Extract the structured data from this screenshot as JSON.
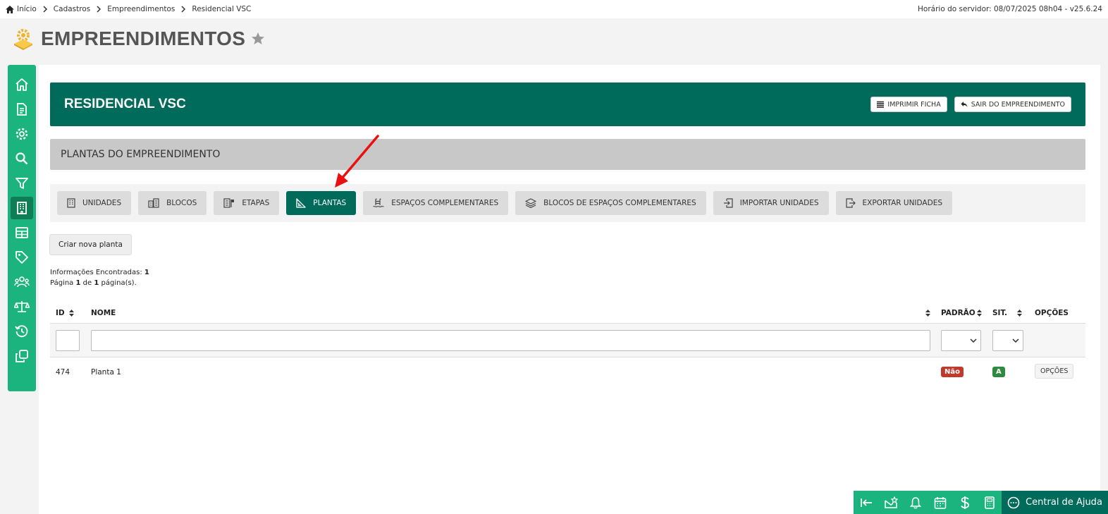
{
  "breadcrumb": {
    "items": [
      "Início",
      "Cadastros",
      "Empreendimentos",
      "Residencial VSC"
    ]
  },
  "server_time": "Horário do servidor: 08/07/2025 08h04 - v25.6.24",
  "page": {
    "title": "EMPREENDIMENTOS"
  },
  "sidebar": {
    "items": [
      {
        "icon": "home-icon"
      },
      {
        "icon": "document-icon"
      },
      {
        "icon": "gear-icon"
      },
      {
        "icon": "search-icon"
      },
      {
        "icon": "filter-icon"
      },
      {
        "icon": "building-icon",
        "active": true
      },
      {
        "icon": "table-icon"
      },
      {
        "icon": "tag-icon"
      },
      {
        "icon": "users-icon"
      },
      {
        "icon": "scale-icon"
      },
      {
        "icon": "history-icon"
      },
      {
        "icon": "copy-icon"
      }
    ]
  },
  "header": {
    "title": "RESIDENCIAL VSC",
    "print_label": "IMPRIMIR FICHA",
    "exit_label": "SAIR DO EMPREENDIMENTO"
  },
  "section": {
    "title": "PLANTAS DO EMPREENDIMENTO"
  },
  "tabs": [
    {
      "label": "UNIDADES",
      "icon": "building-icon"
    },
    {
      "label": "BLOCOS",
      "icon": "blocks-icon"
    },
    {
      "label": "ETAPAS",
      "icon": "stages-icon"
    },
    {
      "label": "PLANTAS",
      "icon": "ruler-triangle-icon",
      "active": true
    },
    {
      "label": "ESPAÇOS COMPLEMENTARES",
      "icon": "pool-icon"
    },
    {
      "label": "BLOCOS DE ESPAÇOS COMPLEMENTARES",
      "icon": "layers-icon"
    },
    {
      "label": "IMPORTAR UNIDADES",
      "icon": "import-icon"
    },
    {
      "label": "EXPORTAR UNIDADES",
      "icon": "export-icon"
    }
  ],
  "actions": {
    "new_plan": "Criar nova planta"
  },
  "info": {
    "found_label": "Informações Encontradas:",
    "found_count": "1",
    "page_prefix": "Página",
    "page_current": "1",
    "page_of": "de",
    "page_total": "1",
    "page_suffix": "página(s)."
  },
  "table": {
    "columns": {
      "id": "ID",
      "name": "NOME",
      "default": "PADRÃO",
      "status": "SIT.",
      "options": "OPÇÕES"
    },
    "rows": [
      {
        "id": "474",
        "name": "Planta 1",
        "default": "Não",
        "status": "A",
        "options": "OPÇÕES"
      }
    ]
  },
  "footer": {
    "help_label": "Central de Ajuda"
  },
  "colors": {
    "primary": "#006b5a",
    "sidebar": "#1cb47e",
    "badge_no": "#c0392b",
    "badge_active": "#2e8b3e",
    "annotation_arrow": "#e81010"
  }
}
